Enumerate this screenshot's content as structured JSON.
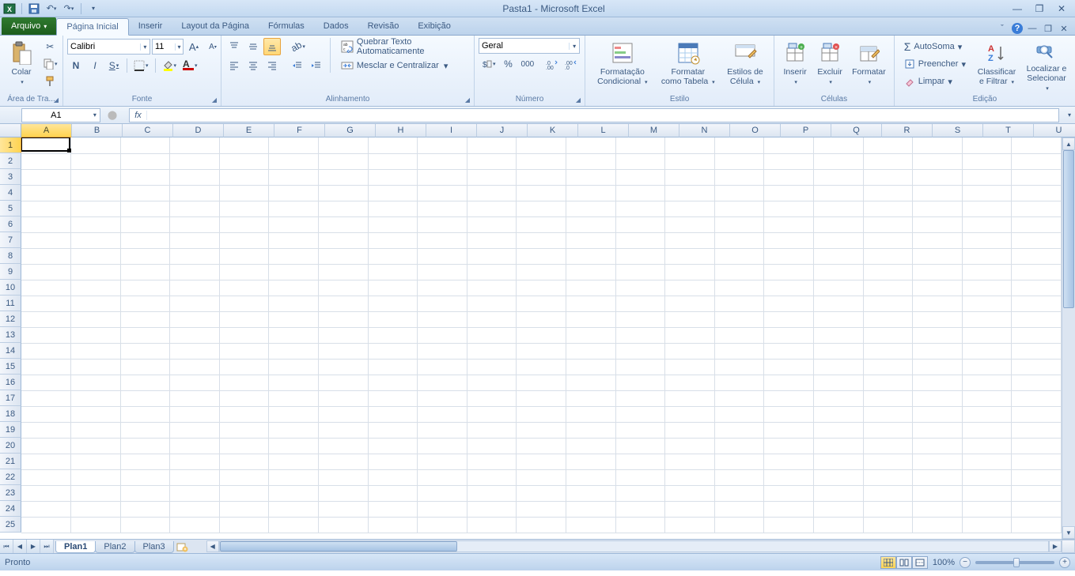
{
  "title": "Pasta1  -  Microsoft Excel",
  "qat": {
    "save": "save",
    "undo": "undo",
    "redo": "redo"
  },
  "tabs": {
    "file": "Arquivo",
    "items": [
      "Página Inicial",
      "Inserir",
      "Layout da Página",
      "Fórmulas",
      "Dados",
      "Revisão",
      "Exibição"
    ],
    "active": 0
  },
  "ribbon": {
    "clipboard": {
      "paste": "Colar",
      "label": "Área de Tra..."
    },
    "font": {
      "name": "Calibri",
      "size": "11",
      "label": "Fonte"
    },
    "alignment": {
      "wrap": "Quebrar Texto Automaticamente",
      "merge": "Mesclar e Centralizar",
      "label": "Alinhamento"
    },
    "number": {
      "format": "Geral",
      "label": "Número"
    },
    "styles": {
      "cond": "Formatação Condicional",
      "table": "Formatar como Tabela",
      "cell": "Estilos de Célula",
      "label": "Estilo"
    },
    "cells": {
      "insert": "Inserir",
      "delete": "Excluir",
      "format": "Formatar",
      "label": "Células"
    },
    "editing": {
      "sum": "AutoSoma",
      "fill": "Preencher",
      "clear": "Limpar",
      "sort": "Classificar e Filtrar",
      "find": "Localizar e Selecionar",
      "label": "Edição"
    }
  },
  "namebox": "A1",
  "columns": [
    "A",
    "B",
    "C",
    "D",
    "E",
    "F",
    "G",
    "H",
    "I",
    "J",
    "K",
    "L",
    "M",
    "N",
    "O",
    "P",
    "Q",
    "R",
    "S",
    "T",
    "U"
  ],
  "rows": [
    "1",
    "2",
    "3",
    "4",
    "5",
    "6",
    "7",
    "8",
    "9",
    "10",
    "11",
    "12",
    "13",
    "14",
    "15",
    "16",
    "17",
    "18",
    "19",
    "20",
    "21",
    "22",
    "23",
    "24",
    "25"
  ],
  "active_cell": {
    "col": 0,
    "row": 0
  },
  "sheets": {
    "items": [
      "Plan1",
      "Plan2",
      "Plan3"
    ],
    "active": 0
  },
  "status": {
    "ready": "Pronto",
    "zoom": "100%"
  }
}
